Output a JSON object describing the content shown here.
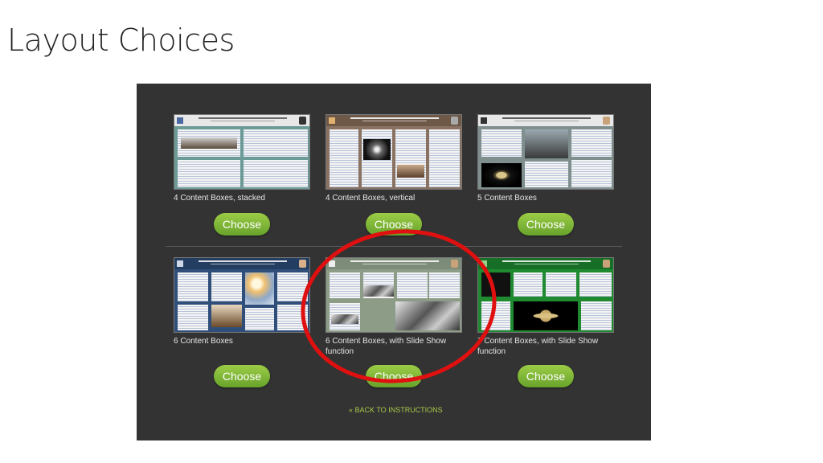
{
  "slide": {
    "title": "Layout Choices"
  },
  "colors": {
    "accent_green": "#7ab536",
    "highlight_red": "#e01010",
    "panel_bg": "#333333"
  },
  "layouts": [
    {
      "label": "4 Content Boxes, stacked",
      "button": "Choose",
      "theme": "teal"
    },
    {
      "label": "4 Content Boxes, vertical",
      "button": "Choose",
      "theme": "brown"
    },
    {
      "label": "5 Content Boxes",
      "button": "Choose",
      "theme": "slate"
    },
    {
      "label": "6 Content Boxes",
      "button": "Choose",
      "theme": "navy"
    },
    {
      "label": "6 Content Boxes, with Slide Show function",
      "button": "Choose",
      "theme": "sage"
    },
    {
      "label": "7 Content Boxes, with Slide Show function",
      "button": "Choose",
      "theme": "green"
    }
  ],
  "back_link": "« BACK TO INSTRUCTIONS"
}
